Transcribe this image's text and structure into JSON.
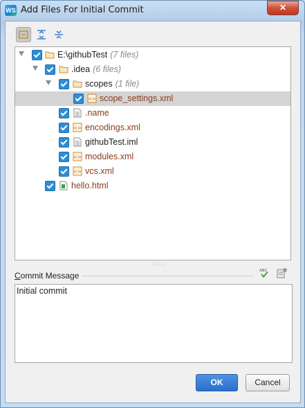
{
  "window": {
    "title": "Add Files For Initial Commit",
    "app_icon_text": "WS"
  },
  "toolbar": {
    "icons": [
      "group-by-directory-icon",
      "expand-all-icon",
      "collapse-all-icon"
    ]
  },
  "tree": {
    "rows": [
      {
        "label": "E:\\githubTest",
        "count": "(7 files)",
        "icon": "folder",
        "expanded": true,
        "modified": false
      },
      {
        "label": ".idea",
        "count": "(6 files)",
        "icon": "folder",
        "expanded": true,
        "modified": false
      },
      {
        "label": "scopes",
        "count": "(1 file)",
        "icon": "folder",
        "expanded": true,
        "modified": false
      },
      {
        "label": "scope_settings.xml",
        "count": "",
        "icon": "xml",
        "modified": true,
        "selected": true
      },
      {
        "label": ".name",
        "count": "",
        "icon": "text",
        "modified": true
      },
      {
        "label": "encodings.xml",
        "count": "",
        "icon": "xml",
        "modified": true
      },
      {
        "label": "githubTest.iml",
        "count": "",
        "icon": "text",
        "modified": false
      },
      {
        "label": "modules.xml",
        "count": "",
        "icon": "xml",
        "modified": true
      },
      {
        "label": "vcs.xml",
        "count": "",
        "icon": "xml",
        "modified": true
      },
      {
        "label": "hello.html",
        "count": "",
        "icon": "html",
        "modified": true
      }
    ]
  },
  "commit": {
    "label": "Commit Message",
    "label_mnemonic": "C",
    "label_rest": "ommit Message",
    "message": "Initial commit"
  },
  "buttons": {
    "ok": "OK",
    "cancel": "Cancel"
  },
  "colors": {
    "checkbox": "#2d8ed8",
    "modified_text": "#8a3b1d",
    "ok_button": "#2b6fcc",
    "folder": "#c8922f"
  }
}
